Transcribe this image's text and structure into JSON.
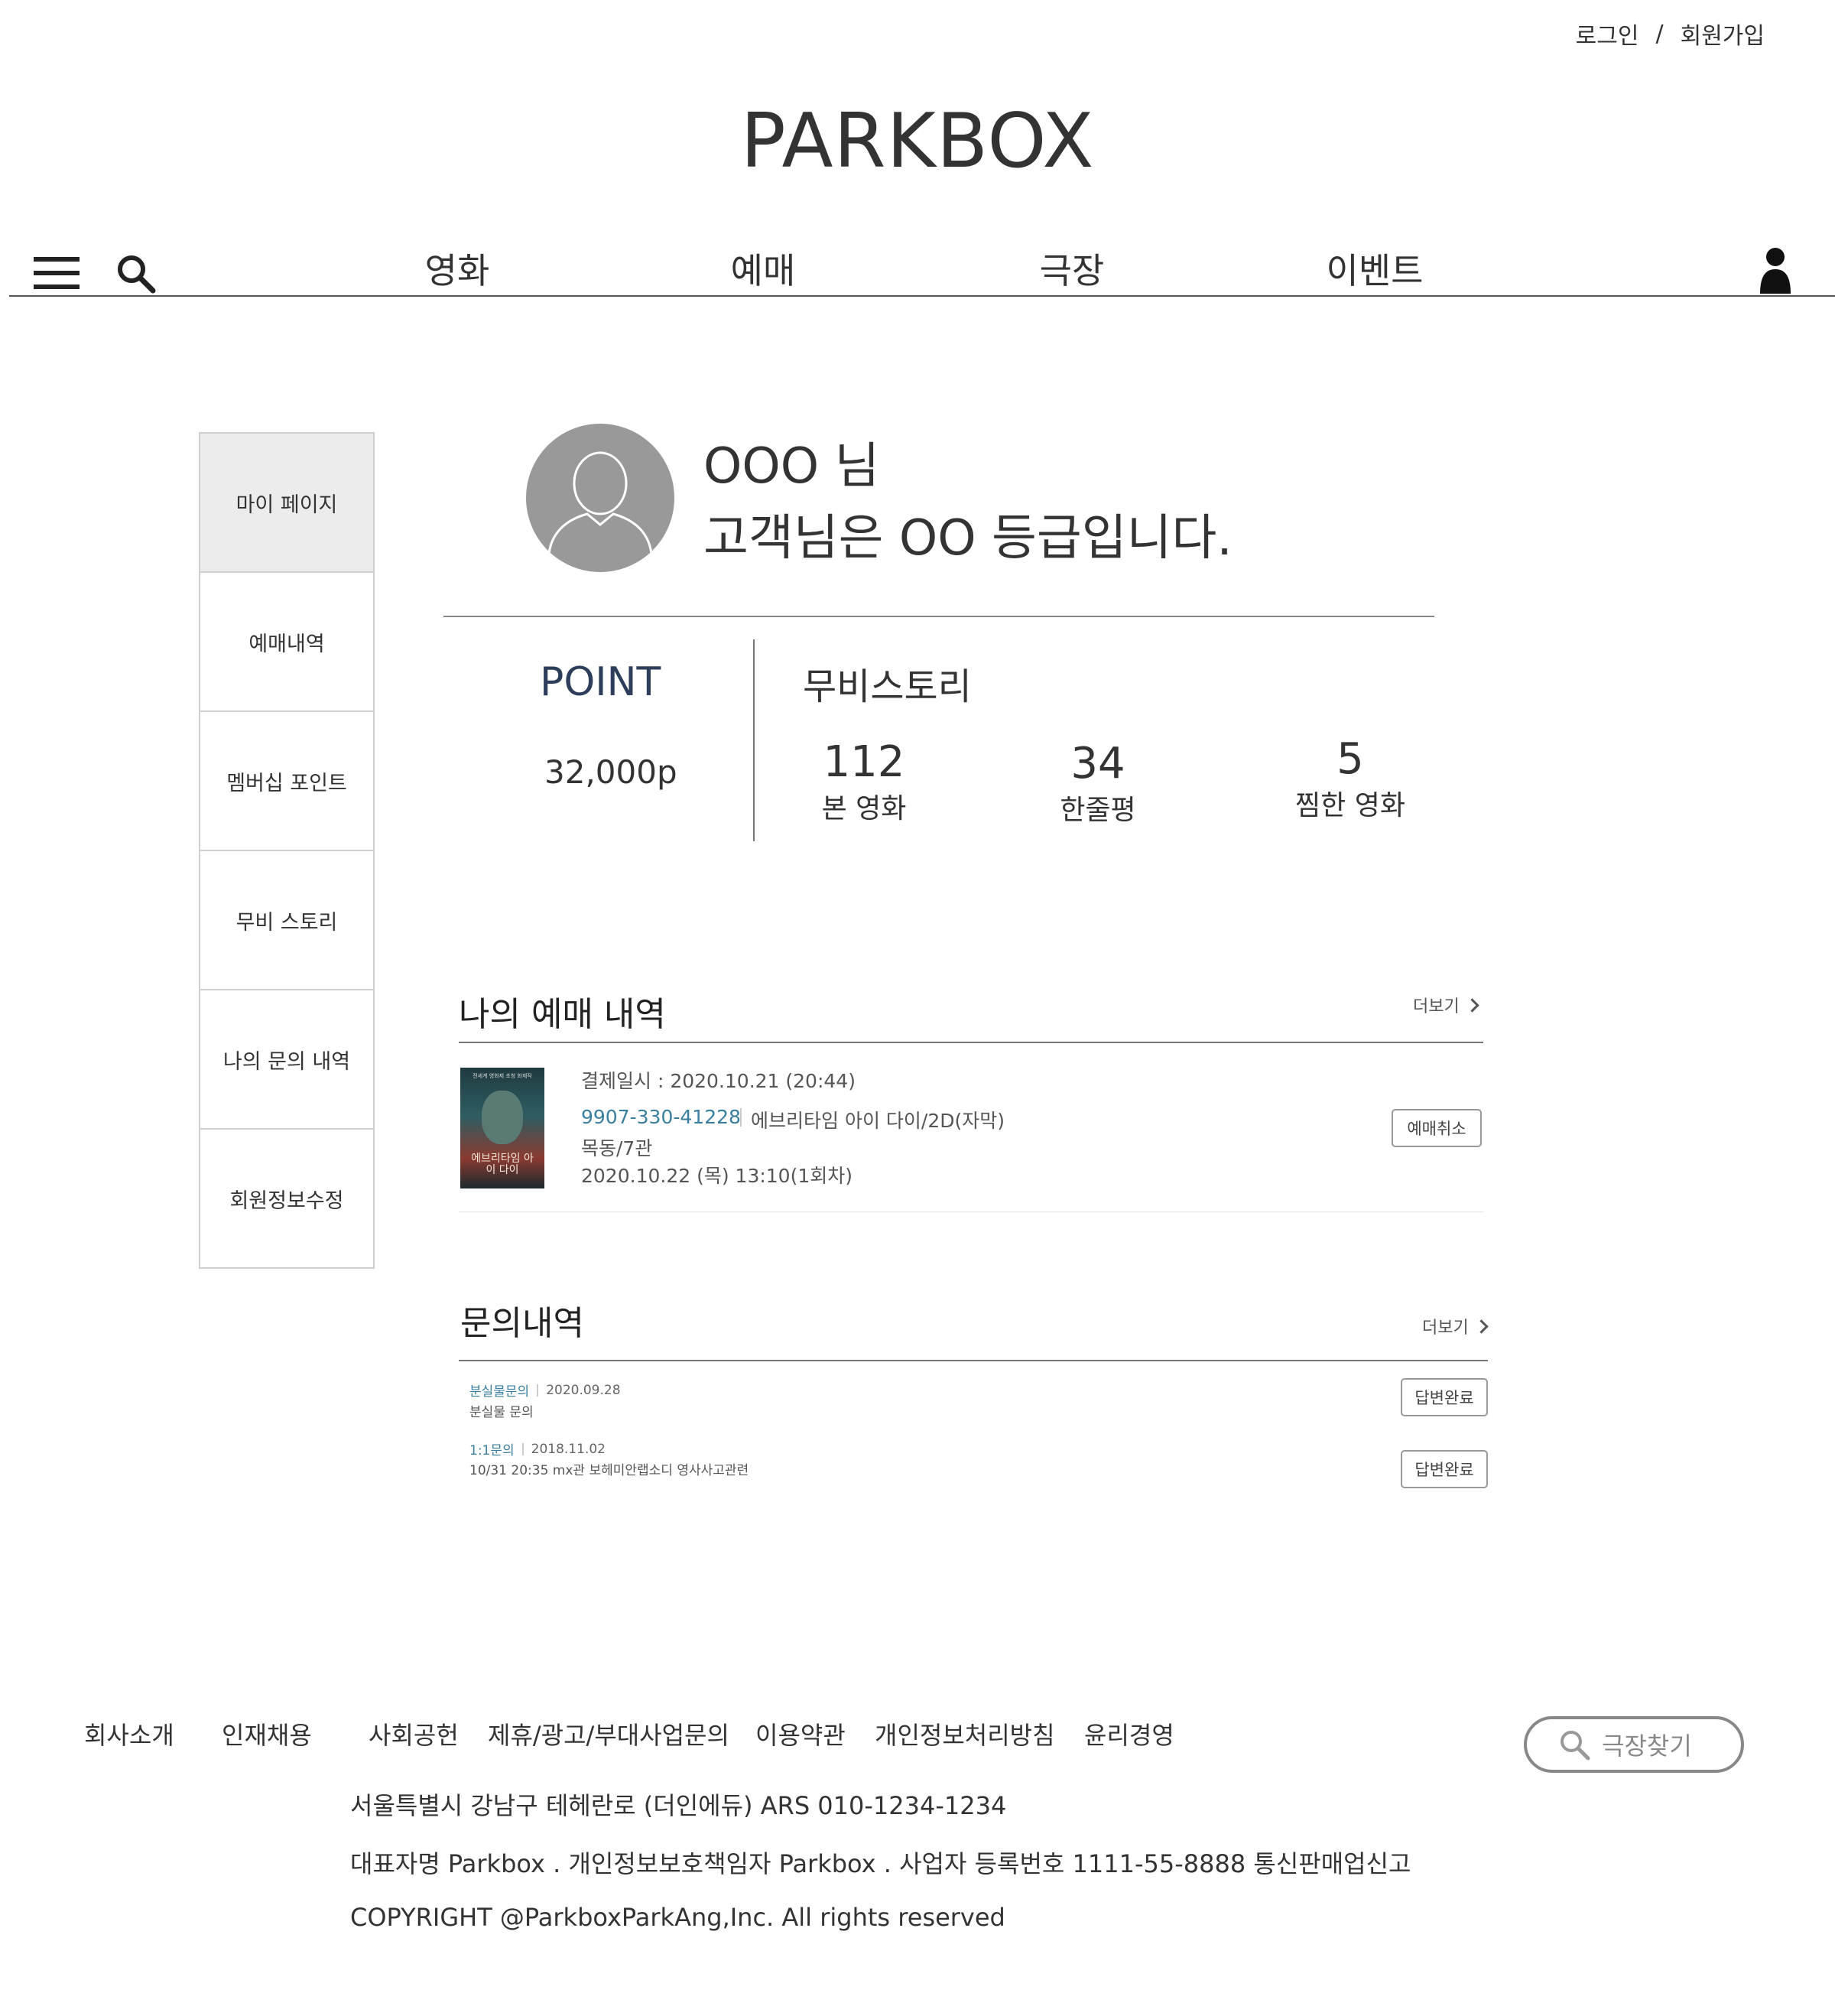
{
  "header": {
    "login": "로그인",
    "separator": "/",
    "signup": "회원가입",
    "logo": "PARKBOX"
  },
  "nav": {
    "items": [
      {
        "label": "영화"
      },
      {
        "label": "예매"
      },
      {
        "label": "극장"
      },
      {
        "label": "이벤트"
      }
    ],
    "icons": [
      "menu-icon",
      "search-icon",
      "user-icon"
    ]
  },
  "sidebar": {
    "items": [
      {
        "label": "마이 페이지",
        "active": true
      },
      {
        "label": "예매내역"
      },
      {
        "label": "멤버십 포인트"
      },
      {
        "label": "무비 스토리"
      },
      {
        "label": "나의 문의 내역"
      },
      {
        "label": "회원정보수정"
      }
    ]
  },
  "profile": {
    "name": "OOO 님",
    "grade_text": "고객님은 OO 등급입니다."
  },
  "point": {
    "title": "POINT",
    "value": "32,000p"
  },
  "movie_story": {
    "title": "무비스토리",
    "stats": [
      {
        "value": "112",
        "label": "본 영화"
      },
      {
        "value": "34",
        "label": "한줄평"
      },
      {
        "value": "5",
        "label": "찜한 영화"
      }
    ]
  },
  "reservations": {
    "title": "나의 예매 내역",
    "more": "더보기",
    "item": {
      "poster_title": "에브리타임 아이 다이",
      "poster_tagline": "전세계 영화제 초청 화제작",
      "payment_date": "결제일시 : 2020.10.21 (20:44)",
      "booking_number": "9907-330-41228",
      "movie": "에브리타임 아이 다이/2D(자막)",
      "theater": "목동/7관",
      "showtime": "2020.10.22 (목) 13:10(1회차)",
      "cancel_button": "예매취소"
    }
  },
  "inquiries": {
    "title": "문의내역",
    "more": "더보기",
    "items": [
      {
        "category": "분실물문의",
        "date": "2020.09.28",
        "body": "분실물 문의",
        "status": "답변완료"
      },
      {
        "category": "1:1문의",
        "date": "2018.11.02",
        "body": "10/31 20:35 mx관 보헤미안랩소디 영사사고관련",
        "status": "답변완료"
      }
    ]
  },
  "footer": {
    "links": [
      {
        "label": "회사소개"
      },
      {
        "label": "인재채용"
      },
      {
        "label": "사회공헌"
      },
      {
        "label": "제휴/광고/부대사업문의"
      },
      {
        "label": "이용약관"
      },
      {
        "label": "개인정보처리방침"
      },
      {
        "label": "윤리경영"
      }
    ],
    "theater_search": "극장찾기",
    "address": "서울특별시 강남구 테헤란로 (더인에듀) ARS 010-1234-1234",
    "company": "대표자명 Parkbox . 개인정보보호책임자 Parkbox . 사업자 등록번호 1111-55-8888 통신판매업신고",
    "copyright": "COPYRIGHT @ParkboxParkAng,Inc. All rights reserved"
  },
  "colors": {
    "accent_blue": "#3a7fa0",
    "point_title": "#2c3e5a",
    "sidebar_active": "#ececec",
    "avatar_gray": "#999999"
  }
}
